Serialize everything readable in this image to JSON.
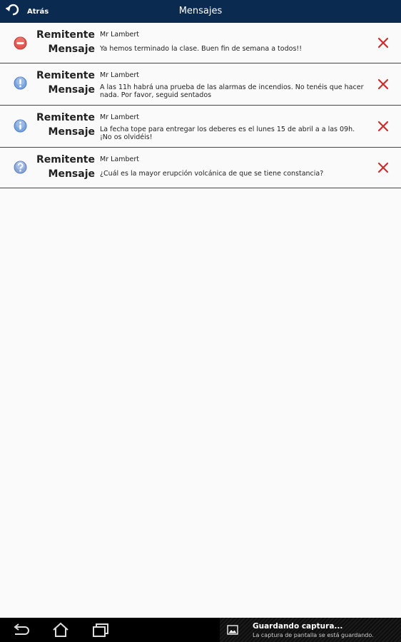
{
  "header": {
    "back_label": "Atrás",
    "title": "Mensajes"
  },
  "labels": {
    "sender": "Remitente",
    "message": "Mensaje"
  },
  "messages": [
    {
      "icon": "stop-icon",
      "icon_color": "#d9534f",
      "sender": "Mr Lambert",
      "text": "Ya hemos terminado la clase. Buen fin de semana a todos!!"
    },
    {
      "icon": "exclamation-icon",
      "icon_color": "#6f9ed9",
      "sender": "Mr Lambert",
      "text": "A las 11h habrá una prueba de las alarmas de incendios. No tenéis que hacer nada. Por favor, seguid sentados"
    },
    {
      "icon": "info-icon",
      "icon_color": "#6f9ed9",
      "sender": "Mr Lambert",
      "text": "La fecha tope para entregar los deberes es el lunes 15 de abril a a las 09h. ¡No os olvidéis!"
    },
    {
      "icon": "question-icon",
      "icon_color": "#8aa6d8",
      "sender": "Mr Lambert",
      "text": "¿Cuál es la mayor erupción volcánica de que se tiene constancia?"
    }
  ],
  "notification": {
    "title": "Guardando captura...",
    "text": "La captura de pantalla se está guardando."
  },
  "colors": {
    "topbar": "#0a2a4f",
    "delete": "#d22b2b"
  }
}
